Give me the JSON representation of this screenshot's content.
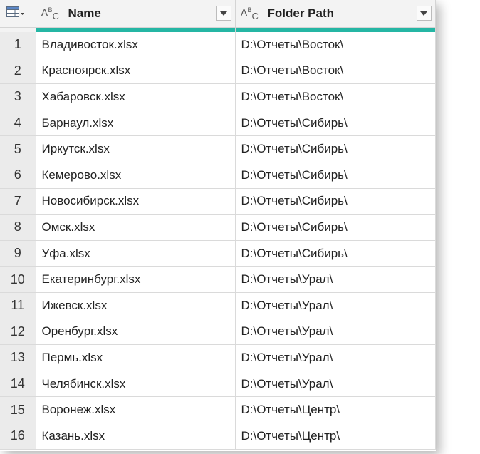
{
  "columns": [
    {
      "type_glyph": {
        "a": "A",
        "b": "B",
        "c": "C"
      },
      "label": "Name"
    },
    {
      "type_glyph": {
        "a": "A",
        "b": "B",
        "c": "C"
      },
      "label": "Folder Path"
    }
  ],
  "icons": {
    "table_menu": "table-icon",
    "dropdown": "chevron-down-icon",
    "column_type": "text-type-icon"
  },
  "colors": {
    "quality_bar": "#25b6a4",
    "header_bg": "#f3f3f3",
    "index_bg": "#ebebeb"
  },
  "rows": [
    {
      "index": "1",
      "name": "Владивосток.xlsx",
      "folder": "D:\\Отчеты\\Восток\\"
    },
    {
      "index": "2",
      "name": "Красноярск.xlsx",
      "folder": "D:\\Отчеты\\Восток\\"
    },
    {
      "index": "3",
      "name": "Хабаровск.xlsx",
      "folder": "D:\\Отчеты\\Восток\\"
    },
    {
      "index": "4",
      "name": "Барнаул.xlsx",
      "folder": "D:\\Отчеты\\Сибирь\\"
    },
    {
      "index": "5",
      "name": "Иркутск.xlsx",
      "folder": "D:\\Отчеты\\Сибирь\\"
    },
    {
      "index": "6",
      "name": "Кемерово.xlsx",
      "folder": "D:\\Отчеты\\Сибирь\\"
    },
    {
      "index": "7",
      "name": "Новосибирск.xlsx",
      "folder": "D:\\Отчеты\\Сибирь\\"
    },
    {
      "index": "8",
      "name": "Омск.xlsx",
      "folder": "D:\\Отчеты\\Сибирь\\"
    },
    {
      "index": "9",
      "name": "Уфа.xlsx",
      "folder": "D:\\Отчеты\\Сибирь\\"
    },
    {
      "index": "10",
      "name": "Екатеринбург.xlsx",
      "folder": "D:\\Отчеты\\Урал\\"
    },
    {
      "index": "11",
      "name": "Ижевск.xlsx",
      "folder": "D:\\Отчеты\\Урал\\"
    },
    {
      "index": "12",
      "name": "Оренбург.xlsx",
      "folder": "D:\\Отчеты\\Урал\\"
    },
    {
      "index": "13",
      "name": "Пермь.xlsx",
      "folder": "D:\\Отчеты\\Урал\\"
    },
    {
      "index": "14",
      "name": "Челябинск.xlsx",
      "folder": "D:\\Отчеты\\Урал\\"
    },
    {
      "index": "15",
      "name": "Воронеж.xlsx",
      "folder": "D:\\Отчеты\\Центр\\"
    },
    {
      "index": "16",
      "name": "Казань.xlsx",
      "folder": "D:\\Отчеты\\Центр\\"
    }
  ]
}
